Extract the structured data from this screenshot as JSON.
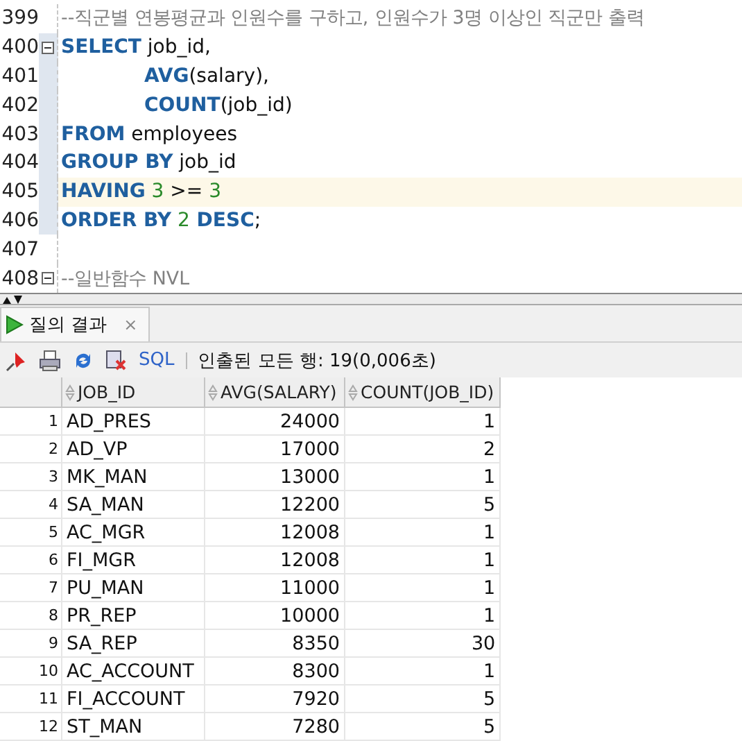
{
  "editor": {
    "lines": [
      {
        "number": "399",
        "fold": false,
        "block": false,
        "current": false,
        "tokens": [
          {
            "kind": "comment",
            "text": "--직군별 연봉평균과 인원수를 구하고, 인원수가 3명 이상인 직군만 출력"
          }
        ]
      },
      {
        "number": "400",
        "fold": true,
        "block": true,
        "current": false,
        "tokens": [
          {
            "kind": "keyword",
            "text": "SELECT"
          },
          {
            "kind": "plain",
            "text": " job_id,"
          }
        ]
      },
      {
        "number": "401",
        "fold": false,
        "block": true,
        "current": false,
        "indent": true,
        "tokens": [
          {
            "kind": "keyword",
            "text": "AVG"
          },
          {
            "kind": "plain",
            "text": "(salary),"
          }
        ]
      },
      {
        "number": "402",
        "fold": false,
        "block": true,
        "current": false,
        "indent": true,
        "tokens": [
          {
            "kind": "keyword",
            "text": "COUNT"
          },
          {
            "kind": "plain",
            "text": "(job_id)"
          }
        ]
      },
      {
        "number": "403",
        "fold": false,
        "block": true,
        "current": false,
        "tokens": [
          {
            "kind": "keyword",
            "text": "FROM"
          },
          {
            "kind": "plain",
            "text": " employees"
          }
        ]
      },
      {
        "number": "404",
        "fold": false,
        "block": true,
        "current": false,
        "tokens": [
          {
            "kind": "keyword",
            "text": "GROUP BY"
          },
          {
            "kind": "plain",
            "text": " job_id"
          }
        ]
      },
      {
        "number": "405",
        "fold": false,
        "block": true,
        "current": true,
        "tokens": [
          {
            "kind": "keyword",
            "text": "HAVING"
          },
          {
            "kind": "number",
            "text": " 3"
          },
          {
            "kind": "plain",
            "text": " >= "
          },
          {
            "kind": "number",
            "text": "3"
          }
        ]
      },
      {
        "number": "406",
        "fold": false,
        "block": true,
        "current": false,
        "tokens": [
          {
            "kind": "keyword",
            "text": "ORDER BY"
          },
          {
            "kind": "number",
            "text": " 2"
          },
          {
            "kind": "keyword",
            "text": " DESC"
          },
          {
            "kind": "plain",
            "text": ";"
          }
        ]
      },
      {
        "number": "407",
        "fold": false,
        "block": false,
        "current": false
      },
      {
        "number": "408",
        "fold": true,
        "block": false,
        "current": false,
        "tokens": [
          {
            "kind": "comment",
            "text": "--일반함수 NVL"
          }
        ]
      }
    ]
  },
  "results_tab": {
    "label": "질의 결과",
    "close": "×"
  },
  "toolbar": {
    "sql_link": "SQL",
    "status": "인출된 모든 행: 19(0,006초)"
  },
  "table": {
    "columns": [
      "JOB_ID",
      "AVG(SALARY)",
      "COUNT(JOB_ID)"
    ],
    "rows": [
      {
        "index": "1",
        "cells": [
          "AD_PRES",
          "24000",
          "1"
        ]
      },
      {
        "index": "2",
        "cells": [
          "AD_VP",
          "17000",
          "2"
        ]
      },
      {
        "index": "3",
        "cells": [
          "MK_MAN",
          "13000",
          "1"
        ]
      },
      {
        "index": "4",
        "cells": [
          "SA_MAN",
          "12200",
          "5"
        ]
      },
      {
        "index": "5",
        "cells": [
          "AC_MGR",
          "12008",
          "1"
        ]
      },
      {
        "index": "6",
        "cells": [
          "FI_MGR",
          "12008",
          "1"
        ]
      },
      {
        "index": "7",
        "cells": [
          "PU_MAN",
          "11000",
          "1"
        ]
      },
      {
        "index": "8",
        "cells": [
          "PR_REP",
          "10000",
          "1"
        ]
      },
      {
        "index": "9",
        "cells": [
          "SA_REP",
          "8350",
          "30"
        ]
      },
      {
        "index": "10",
        "cells": [
          "AC_ACCOUNT",
          "8300",
          "1"
        ]
      },
      {
        "index": "11",
        "cells": [
          "FI_ACCOUNT",
          "7920",
          "5"
        ]
      },
      {
        "index": "12",
        "cells": [
          "ST_MAN",
          "7280",
          "5"
        ]
      }
    ]
  }
}
